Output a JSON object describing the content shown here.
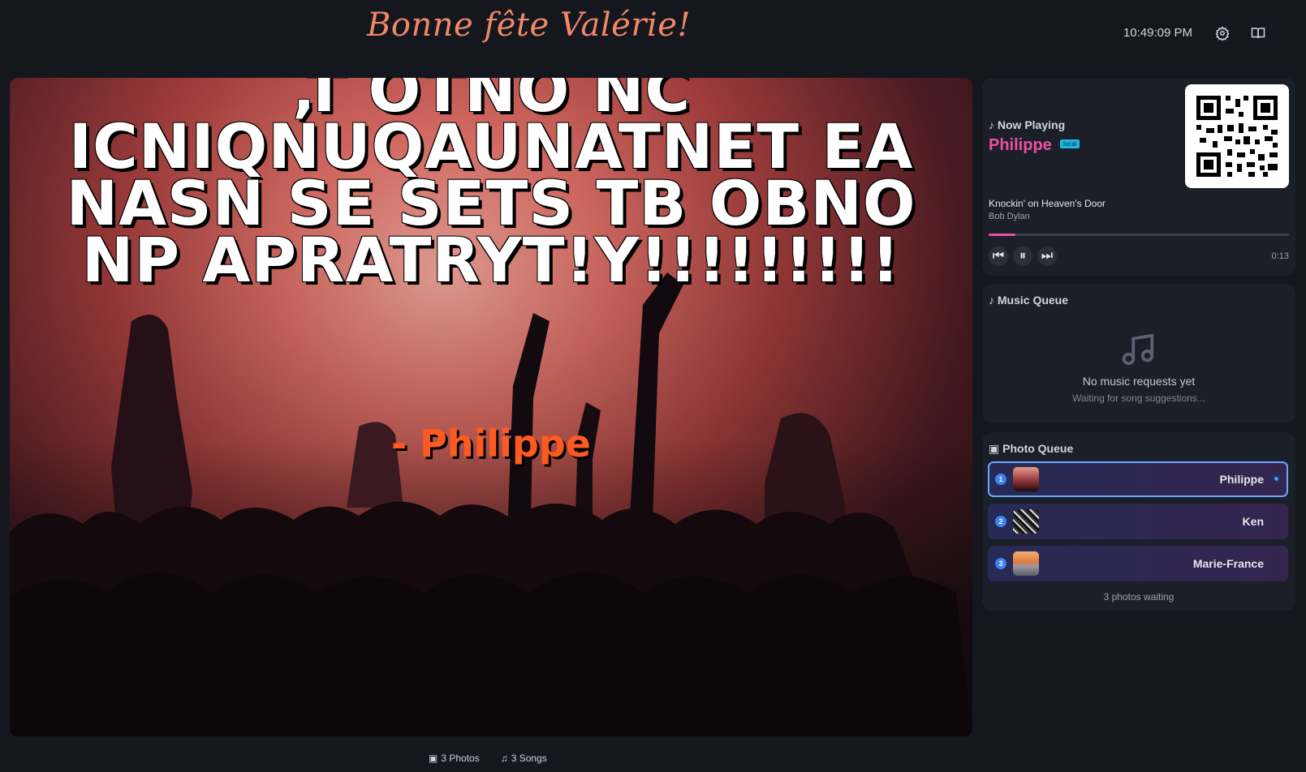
{
  "header": {
    "title": "Bonne fête Valérie!",
    "clock": "10:49:09 PM",
    "icons": [
      "gear-icon",
      "book-icon"
    ]
  },
  "stage": {
    "message": "‚T OTNO NC ICNIQNUQAUNATNET EA NASN SE SETS TB OBNO NP APRATRYT!Y!!!!!!!!!",
    "author": "- Philippe",
    "colors": {
      "message": "#ffffff",
      "author": "#ff5a1f"
    }
  },
  "footer": {
    "photos": "3 Photos",
    "songs": "3 Songs"
  },
  "now_playing": {
    "label": "Now Playing",
    "name": "Philippe",
    "badge": "local",
    "song": "Knockin' on Heaven's Door",
    "artist": "Bob Dylan",
    "progress": 0.09,
    "time": "0:13",
    "accent": "#ec4fa3"
  },
  "music_queue": {
    "title": "Music Queue",
    "empty_main": "No music requests yet",
    "empty_sub": "Waiting for song suggestions..."
  },
  "photo_queue": {
    "title": "Photo Queue",
    "items": [
      {
        "num": "1",
        "name": "Philippe"
      },
      {
        "num": "2",
        "name": "Ken"
      },
      {
        "num": "3",
        "name": "Marie-France"
      }
    ],
    "waiting": "3 photos waiting"
  }
}
